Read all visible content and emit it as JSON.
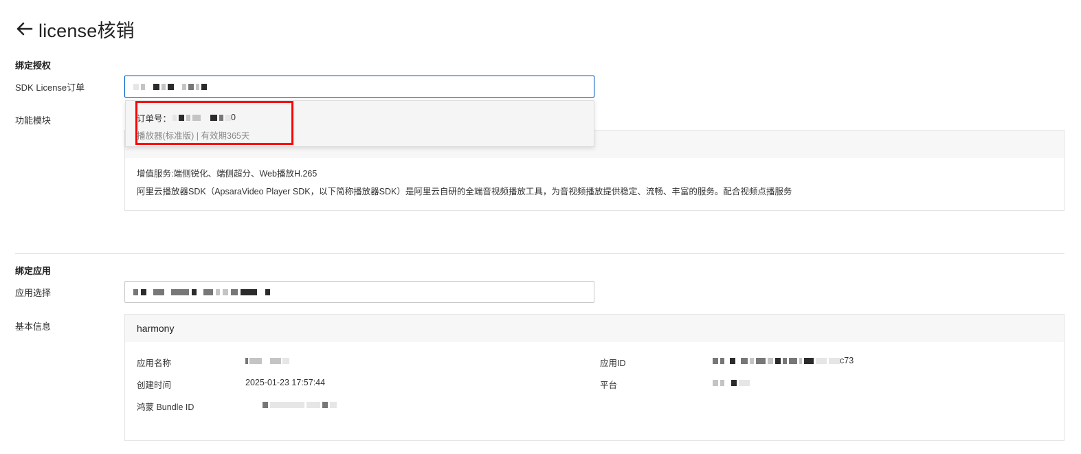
{
  "header": {
    "title": "license核销",
    "back_icon": "arrow-left-icon"
  },
  "bind_license": {
    "section_title": "绑定授权",
    "order_label": "SDK License订单",
    "module_label": "功能模块",
    "dropdown": {
      "order_prefix": "订单号：",
      "order_suffix": "0",
      "order_detail": "播放器(标准版) | 有效期365天"
    },
    "module_card": {
      "header": "",
      "value_services": "增值服务:端侧锐化、端侧超分、Web播放H.265",
      "description": "阿里云播放器SDK（ApsaraVideo Player SDK，以下简称播放器SDK）是阿里云自研的全端音视频播放工具，为音视频播放提供稳定、流畅、丰富的服务。配合视频点播服务"
    }
  },
  "bind_app": {
    "section_title": "绑定应用",
    "app_select_label": "应用选择",
    "basic_info_label": "基本信息",
    "info_card": {
      "header": "harmony",
      "app_name_label": "应用名称",
      "create_time_label": "创建时间",
      "create_time_value": "2025-01-23 17:57:44",
      "bundle_id_label": "鸿蒙 Bundle ID",
      "app_id_label": "应用ID",
      "app_id_suffix": "c73",
      "platform_label": "平台"
    }
  },
  "colors": {
    "focus_border": "#0064c8",
    "highlight": "#ff0000",
    "card_header_bg": "#f7f7f7"
  }
}
